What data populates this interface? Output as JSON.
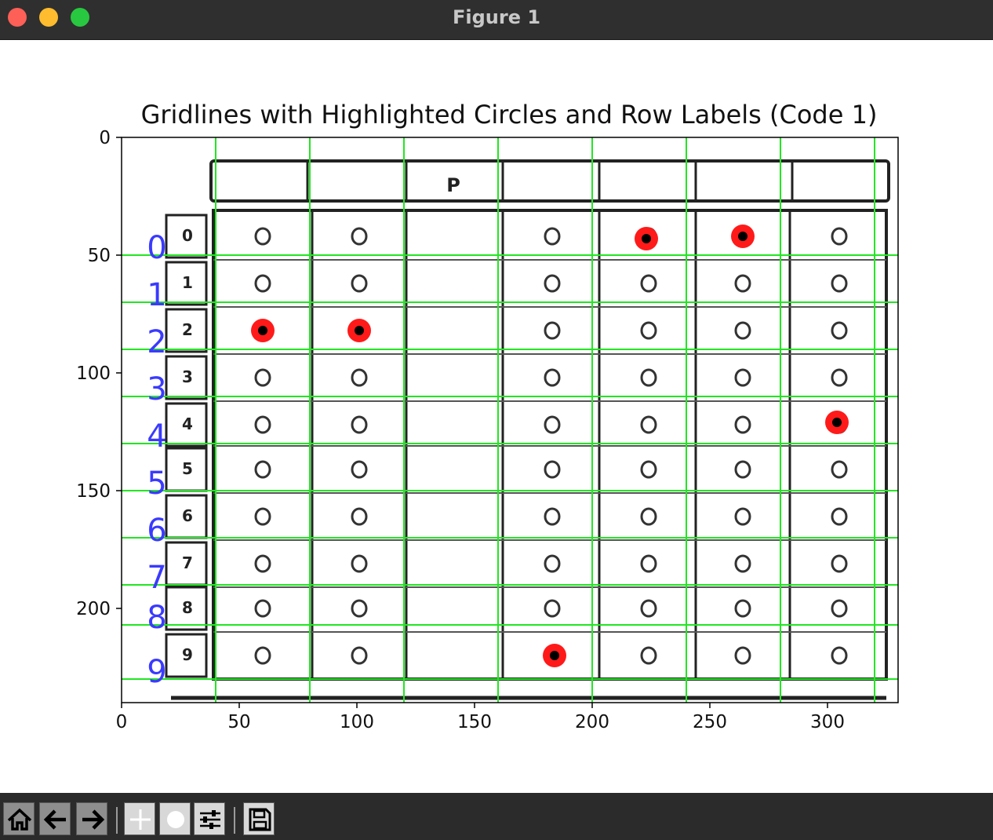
{
  "window": {
    "title": "Figure 1"
  },
  "toolbar": {
    "buttons": [
      {
        "name": "home-button",
        "icon": "home-icon"
      },
      {
        "name": "back-button",
        "icon": "arrow-left-icon"
      },
      {
        "name": "forward-button",
        "icon": "arrow-right-icon"
      },
      {
        "name": "pan-button",
        "icon": "pan-icon"
      },
      {
        "name": "zoom-button",
        "icon": "zoom-icon"
      },
      {
        "name": "configure-subplots-button",
        "icon": "sliders-icon"
      },
      {
        "name": "save-button",
        "icon": "floppy-disk-icon"
      }
    ]
  },
  "chart_data": {
    "type": "scatter",
    "title": "Gridlines with Highlighted Circles and Row Labels (Code 1)",
    "xlabel": "",
    "ylabel": "",
    "xlim": [
      0,
      330
    ],
    "ylim": [
      240,
      0
    ],
    "xticks": [
      0,
      50,
      100,
      150,
      200,
      250,
      300
    ],
    "yticks": [
      0,
      50,
      100,
      150,
      200
    ],
    "background_image": "scanned answer-sheet bubble grid (grayscale)",
    "header_letter": "P",
    "sheet_row_numbers": [
      "0",
      "1",
      "2",
      "3",
      "4",
      "5",
      "6",
      "7",
      "8",
      "9"
    ],
    "row_labels": [
      "0",
      "1",
      "2",
      "3",
      "4",
      "5",
      "6",
      "7",
      "8",
      "9"
    ],
    "row_label_color": "#3a3aff",
    "vertical_gridlines_x": [
      40,
      80,
      120,
      160,
      200,
      240,
      280,
      320
    ],
    "horizontal_gridlines_y": [
      50,
      70,
      90,
      110,
      130,
      150,
      170,
      190,
      207,
      230
    ],
    "gridline_color": "#22e622",
    "bubble_columns_x": [
      60,
      101,
      183,
      224,
      264,
      305
    ],
    "bubble_rows_y": [
      42,
      62,
      82,
      102,
      122,
      141,
      161,
      181,
      200,
      220
    ],
    "highlighted_circles": [
      {
        "x": 223,
        "y": 43
      },
      {
        "x": 264,
        "y": 42
      },
      {
        "x": 60,
        "y": 82
      },
      {
        "x": 101,
        "y": 82
      },
      {
        "x": 304,
        "y": 121
      },
      {
        "x": 184,
        "y": 220
      }
    ],
    "highlight_outer_color": "#ff1a1a",
    "highlight_inner_color": "#000000"
  }
}
